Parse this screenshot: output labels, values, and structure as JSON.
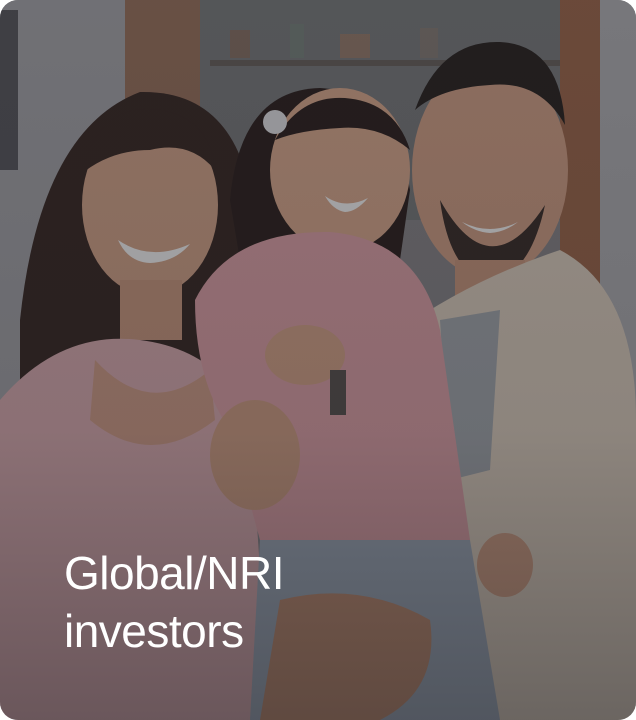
{
  "card": {
    "title_line_1": "Global/NRI",
    "title_line_2": "investors",
    "image": "family-photo-image",
    "overlay_color": "#141418",
    "text_color": "#ffffff"
  }
}
